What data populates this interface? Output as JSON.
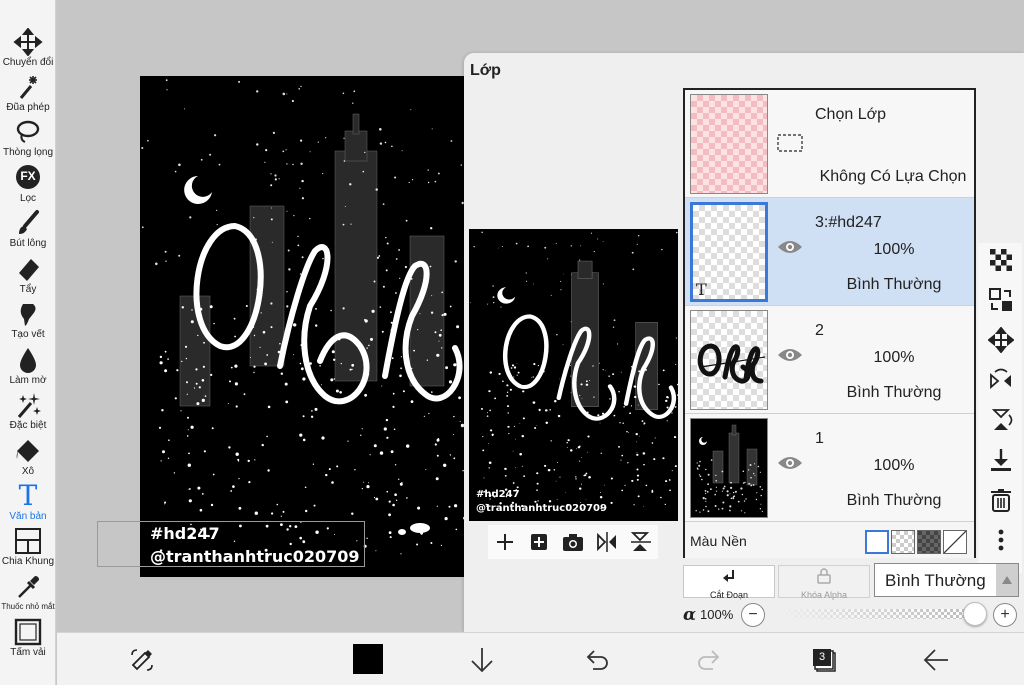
{
  "tools": [
    {
      "label": "Chuyển đổi",
      "icon": "move-icon"
    },
    {
      "label": "Đũa phép",
      "icon": "magic-wand-icon"
    },
    {
      "label": "Thòng lọng",
      "icon": "lasso-icon"
    },
    {
      "label": "Lọc",
      "icon": "fx-filter-icon",
      "badge": "FX"
    },
    {
      "label": "Bút lông",
      "icon": "brush-icon"
    },
    {
      "label": "Tẩy",
      "icon": "eraser-icon"
    },
    {
      "label": "Tạo vết",
      "icon": "smudge-icon"
    },
    {
      "label": "Làm mờ",
      "icon": "blur-icon"
    },
    {
      "label": "Đặc biệt",
      "icon": "special-icon"
    },
    {
      "label": "Xô",
      "icon": "bucket-icon"
    },
    {
      "label": "Văn bản",
      "icon": "text-tool-icon",
      "glyph": "T",
      "active": true
    },
    {
      "label": "Chia Khung",
      "icon": "frame-divider-icon"
    },
    {
      "label": "Thuốc nhỏ mắt",
      "icon": "eyedropper-icon"
    },
    {
      "label": "Tấm vải",
      "icon": "canvas-icon"
    }
  ],
  "artwork": {
    "line1": "#hd247",
    "line2": "@tranthanhtruc020709"
  },
  "layer_panel": {
    "title": "Lớp",
    "selection_row": {
      "name": "Chọn Lớp",
      "status": "Không Có Lựa Chọn"
    },
    "layers": [
      {
        "name": "3:#hd247",
        "opacity": "100%",
        "blend": "Bình Thường",
        "thumb_glyph": "T",
        "selected": true
      },
      {
        "name": "2",
        "opacity": "100%",
        "blend": "Bình Thường",
        "selected": false
      },
      {
        "name": "1",
        "opacity": "100%",
        "blend": "Bình Thường",
        "selected": false
      }
    ],
    "background_label": "Màu Nền",
    "cut_label": "Cắt Đoạn",
    "alpha_lock_label": "Khóa Alpha",
    "blend_mode": "Bình Thường",
    "alpha_symbol": "α",
    "alpha_value": "100%",
    "alpha_fraction": 1.0,
    "minus": "−",
    "plus": "+"
  },
  "bottom_bar": {
    "layer_count": "3",
    "color": "#000000"
  },
  "colors": {
    "accent": "#1a73e8",
    "selected_layer_bg": "#cfdff4",
    "selection_border": "#3b78d8"
  }
}
